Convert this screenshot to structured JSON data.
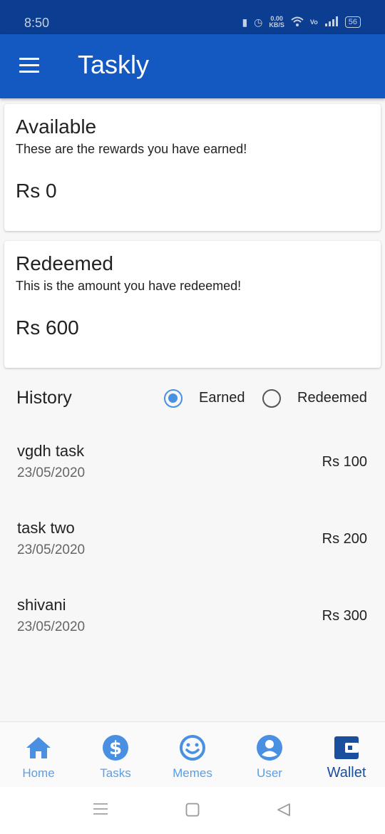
{
  "status_bar": {
    "time": "8:50",
    "net_speed_top": "0.00",
    "net_speed_bottom": "KB/S",
    "battery": "56"
  },
  "app_bar": {
    "title": "Taskly"
  },
  "available": {
    "title": "Available",
    "subtitle": "These are the rewards you have earned!",
    "amount": "Rs 0"
  },
  "redeemed": {
    "title": "Redeemed",
    "subtitle": "This is the amount you have redeemed!",
    "amount": "Rs 600"
  },
  "history": {
    "title": "History",
    "filter_options": [
      "Earned",
      "Redeemed"
    ],
    "selected_filter": "Earned",
    "items": [
      {
        "name": "vgdh task",
        "date": "23/05/2020",
        "amount": "Rs 100"
      },
      {
        "name": "task two",
        "date": "23/05/2020",
        "amount": "Rs 200"
      },
      {
        "name": "shivani",
        "date": "23/05/2020",
        "amount": "Rs 300"
      }
    ]
  },
  "bottom_nav": {
    "items": [
      {
        "label": "Home",
        "icon": "home-icon"
      },
      {
        "label": "Tasks",
        "icon": "dollar-icon"
      },
      {
        "label": "Memes",
        "icon": "smiley-icon"
      },
      {
        "label": "User",
        "icon": "user-icon"
      },
      {
        "label": "Wallet",
        "icon": "wallet-icon"
      }
    ],
    "active": "Wallet"
  },
  "colors": {
    "status_bar": "#0b3d91",
    "app_bar": "#1458c2",
    "accent": "#4a90e2",
    "nav_inactive": "#5a9ee6",
    "nav_active": "#1a4fa0"
  }
}
